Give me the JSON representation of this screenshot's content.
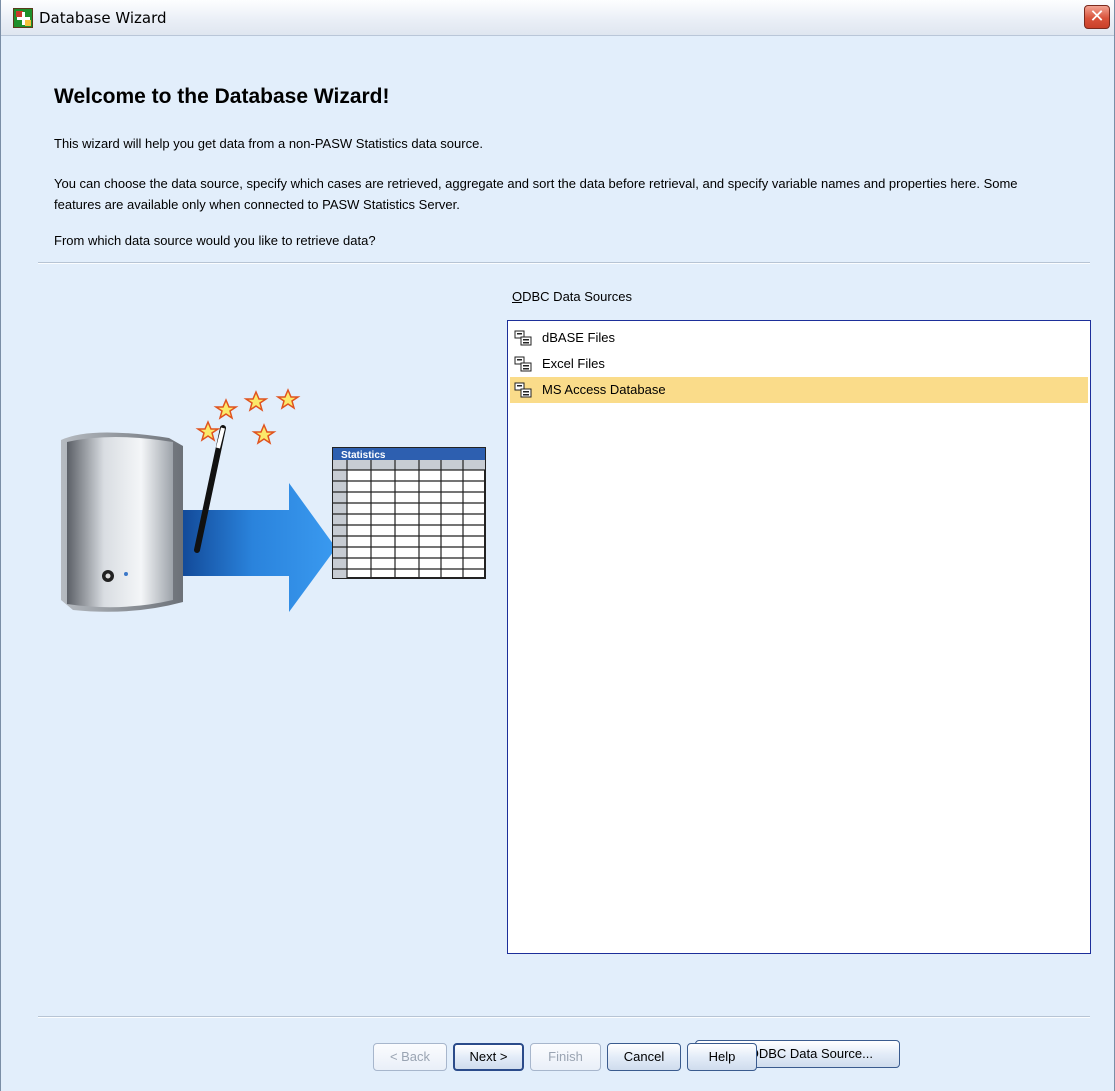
{
  "window": {
    "title": "Database Wizard",
    "close_label": "✕"
  },
  "main": {
    "heading": "Welcome to the Database Wizard!",
    "intro": "This wizard will help you get data from a non-PASW Statistics data source.",
    "description": "You can choose the data source, specify which cases are retrieved, aggregate and sort the data before retrieval, and specify variable names and properties here. Some features are available only when connected to PASW Statistics Server.",
    "question": "From which data source would you like to retrieve data?"
  },
  "illustration": {
    "table_header": "Statistics"
  },
  "data_sources": {
    "label_mnemonic": "O",
    "label_rest": "DBC Data Sources",
    "items": [
      {
        "label": "dBASE Files",
        "selected": false
      },
      {
        "label": "Excel Files",
        "selected": false
      },
      {
        "label": "MS Access Database",
        "selected": true
      }
    ],
    "add_button_mnemonic": "A",
    "add_button_rest": "dd ODBC Data Source..."
  },
  "footer": {
    "back_label": "< Back",
    "next_label": "Next >",
    "finish_label": "Finish",
    "cancel_label": "Cancel",
    "help_label": "Help"
  },
  "colors": {
    "window_bg": "#e2eefb",
    "selection_bg": "#fadc8a",
    "list_border": "#1d2f9a",
    "arrow_blue": "#1e6fd0"
  }
}
